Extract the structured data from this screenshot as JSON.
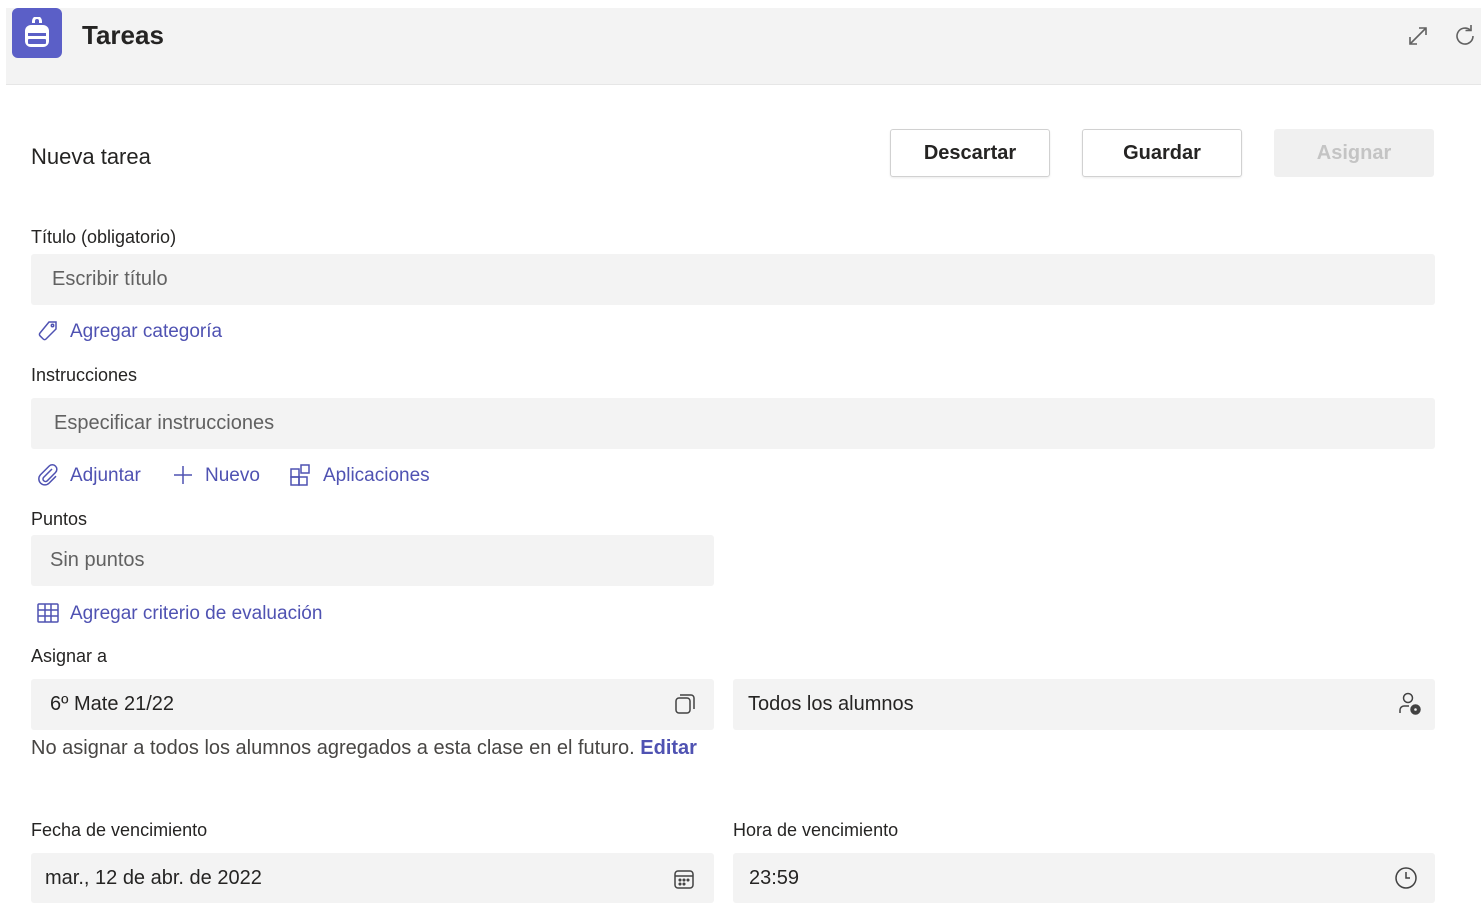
{
  "header": {
    "app_title": "Tareas",
    "icons": [
      "backpack-icon",
      "expand-icon",
      "refresh-icon"
    ]
  },
  "form": {
    "heading": "Nueva tarea",
    "buttons": {
      "discard": "Descartar",
      "save": "Guardar",
      "assign": "Asignar"
    },
    "title_label": "Título (obligatorio)",
    "title_placeholder": "Escribir título",
    "add_category": "Agregar categoría",
    "instructions_label": "Instrucciones",
    "instructions_placeholder": "Especificar instrucciones",
    "attach": "Adjuntar",
    "new": "Nuevo",
    "apps": "Aplicaciones",
    "points_label": "Puntos",
    "points_value": "Sin puntos",
    "add_rubric": "Agregar criterio de evaluación",
    "assign_to_label": "Asignar a",
    "class_value": "6º Mate 21/22",
    "students_value": "Todos los alumnos",
    "note_text": "No asignar a todos los alumnos agregados a esta clase en el futuro.",
    "note_edit": "Editar",
    "due_date_label": "Fecha de vencimiento",
    "due_date_value": "mar., 12 de abr. de 2022",
    "due_time_label": "Hora de vencimiento",
    "due_time_value": "23:59"
  },
  "colors": {
    "accent": "#5b5fc7",
    "link": "#4f52b2",
    "field_bg": "#f3f3f3"
  }
}
